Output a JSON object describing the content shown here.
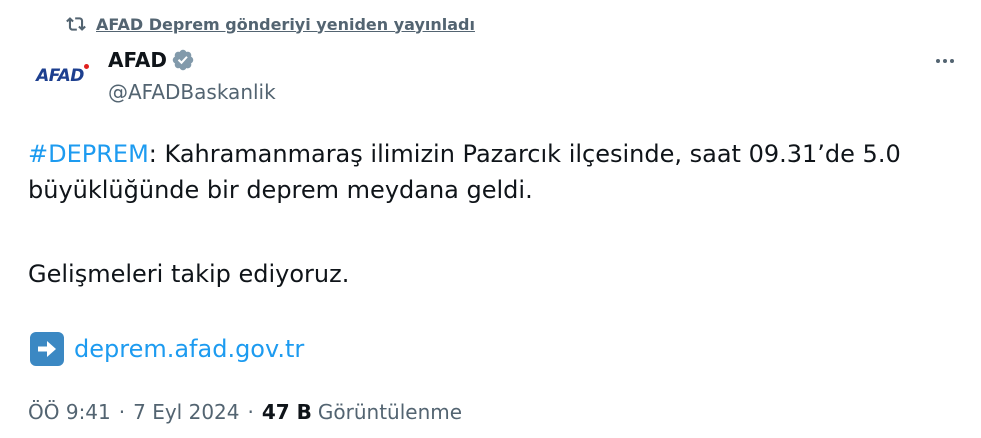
{
  "repost": {
    "label": "AFAD Deprem gönderiyi yeniden yayınladı",
    "icon": "repost-icon"
  },
  "author": {
    "avatar_logo": "AFAD",
    "display_name": "AFAD",
    "handle": "@AFADBaskanlik",
    "verified_icon": "verified-badge-icon",
    "verified_color": "#829aab"
  },
  "tweet": {
    "hashtag": "#DEPREM",
    "line1_rest": ": Kahramanmaraş ilimizin Pazarcık ilçesinde, saat 09.31’de 5.0 büyüklüğünde bir deprem meydana geldi.",
    "line2": "Gelişmeleri takip ediyoruz.",
    "link_icon": "right-arrow-emoji-icon",
    "link": "deprem.afad.gov.tr"
  },
  "meta": {
    "time": "ÖÖ 9:41",
    "separator": "·",
    "date": "7 Eyl 2024",
    "views_count": "47 B",
    "views_label": "Görüntülenme"
  },
  "colors": {
    "text": "#0f1419",
    "secondary": "#536471",
    "link": "#1d9bf0",
    "emoji_blue": "#3b88c3",
    "logo_blue": "#1d3f8f",
    "logo_red": "#e0201e"
  }
}
